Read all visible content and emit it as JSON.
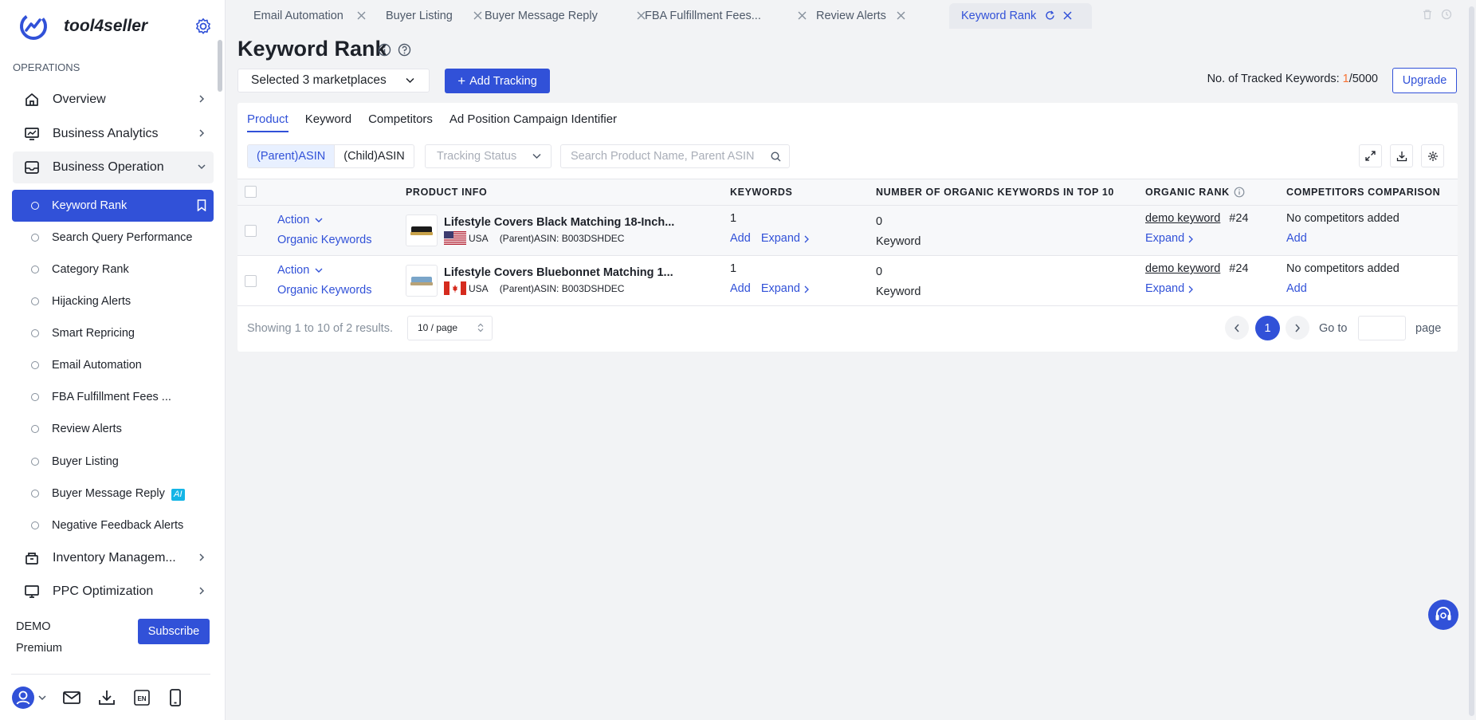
{
  "brand": {
    "name": "tool4seller"
  },
  "sidebar": {
    "section_label": "OPERATIONS",
    "top_items": [
      {
        "label": "Overview",
        "icon": "home-icon"
      },
      {
        "label": "Business Analytics",
        "icon": "analytics-icon"
      },
      {
        "label": "Business Operation",
        "icon": "inbox-icon"
      }
    ],
    "sub_items": [
      {
        "label": "Keyword Rank"
      },
      {
        "label": "Search Query Performance"
      },
      {
        "label": "Category Rank"
      },
      {
        "label": "Hijacking Alerts"
      },
      {
        "label": "Smart Repricing"
      },
      {
        "label": "Email Automation"
      },
      {
        "label": "FBA Fulfillment Fees ..."
      },
      {
        "label": "Review Alerts"
      },
      {
        "label": "Buyer Listing"
      },
      {
        "label": "Buyer Message Reply",
        "badge": "AI"
      },
      {
        "label": "Negative Feedback Alerts"
      }
    ],
    "bottom_items": [
      {
        "label": "Inventory Managem...",
        "icon": "inventory-icon"
      },
      {
        "label": "PPC Optimization",
        "icon": "monitor-icon"
      }
    ],
    "plan": {
      "name": "DEMO",
      "tier": "Premium",
      "subscribe_label": "Subscribe"
    }
  },
  "tabs": [
    {
      "label": "Email Automation"
    },
    {
      "label": "Buyer Listing"
    },
    {
      "label": "Buyer Message Reply"
    },
    {
      "label": "FBA Fulfillment Fees..."
    },
    {
      "label": "Review Alerts"
    },
    {
      "label": "Keyword Rank",
      "active": true
    }
  ],
  "page": {
    "title": "Keyword Rank",
    "marketplace_select": "Selected 3 marketplaces",
    "add_tracking_label": "Add Tracking",
    "tracked_label": "No. of Tracked Keywords: ",
    "tracked_used": "1",
    "tracked_total": "/5000",
    "upgrade_label": "Upgrade"
  },
  "subtabs": [
    "Product",
    "Keyword",
    "Competitors",
    "Ad Position Campaign Identifier"
  ],
  "filters": {
    "parent_asin": "(Parent)ASIN",
    "child_asin": "(Child)ASIN",
    "tracking_status_placeholder": "Tracking Status",
    "search_placeholder": "Search Product Name, Parent ASIN"
  },
  "table": {
    "headers": {
      "product_info": "PRODUCT INFO",
      "keywords": "KEYWORDS",
      "organic_top10": "NUMBER OF ORGANIC KEYWORDS IN TOP 10",
      "organic_rank": "ORGANIC RANK",
      "competitors": "COMPETITORS COMPARISON"
    },
    "rows": [
      {
        "action": "Action",
        "organic_keywords": "Organic Keywords",
        "title": "Lifestyle Covers Black Matching 18-Inch...",
        "country": "USA",
        "asin": "(Parent)ASIN: B003DSHDEC",
        "keywords_count": "1",
        "add": "Add",
        "expand": "Expand",
        "top10_count": "0",
        "top10_unit": "Keyword",
        "rank_keyword": "demo keyword",
        "rank_value": "#24",
        "rank_expand": "Expand",
        "competitors_text": "No competitors added",
        "competitors_add": "Add"
      },
      {
        "action": "Action",
        "organic_keywords": "Organic Keywords",
        "title": "Lifestyle Covers Bluebonnet Matching 1...",
        "country": "USA",
        "asin": "(Parent)ASIN: B003DSHDEC",
        "keywords_count": "1",
        "add": "Add",
        "expand": "Expand",
        "top10_count": "0",
        "top10_unit": "Keyword",
        "rank_keyword": "demo keyword",
        "rank_value": "#24",
        "rank_expand": "Expand",
        "competitors_text": "No competitors added",
        "competitors_add": "Add"
      }
    ]
  },
  "pagination": {
    "showing": "Showing 1 to 10 of 2 results.",
    "per_page": "10 / page",
    "current": "1",
    "goto_label": "Go to",
    "page_label": "page"
  },
  "colors": {
    "primary": "#3151d8",
    "accent_orange": "#f77234",
    "ai_badge": "#14b5e6"
  }
}
